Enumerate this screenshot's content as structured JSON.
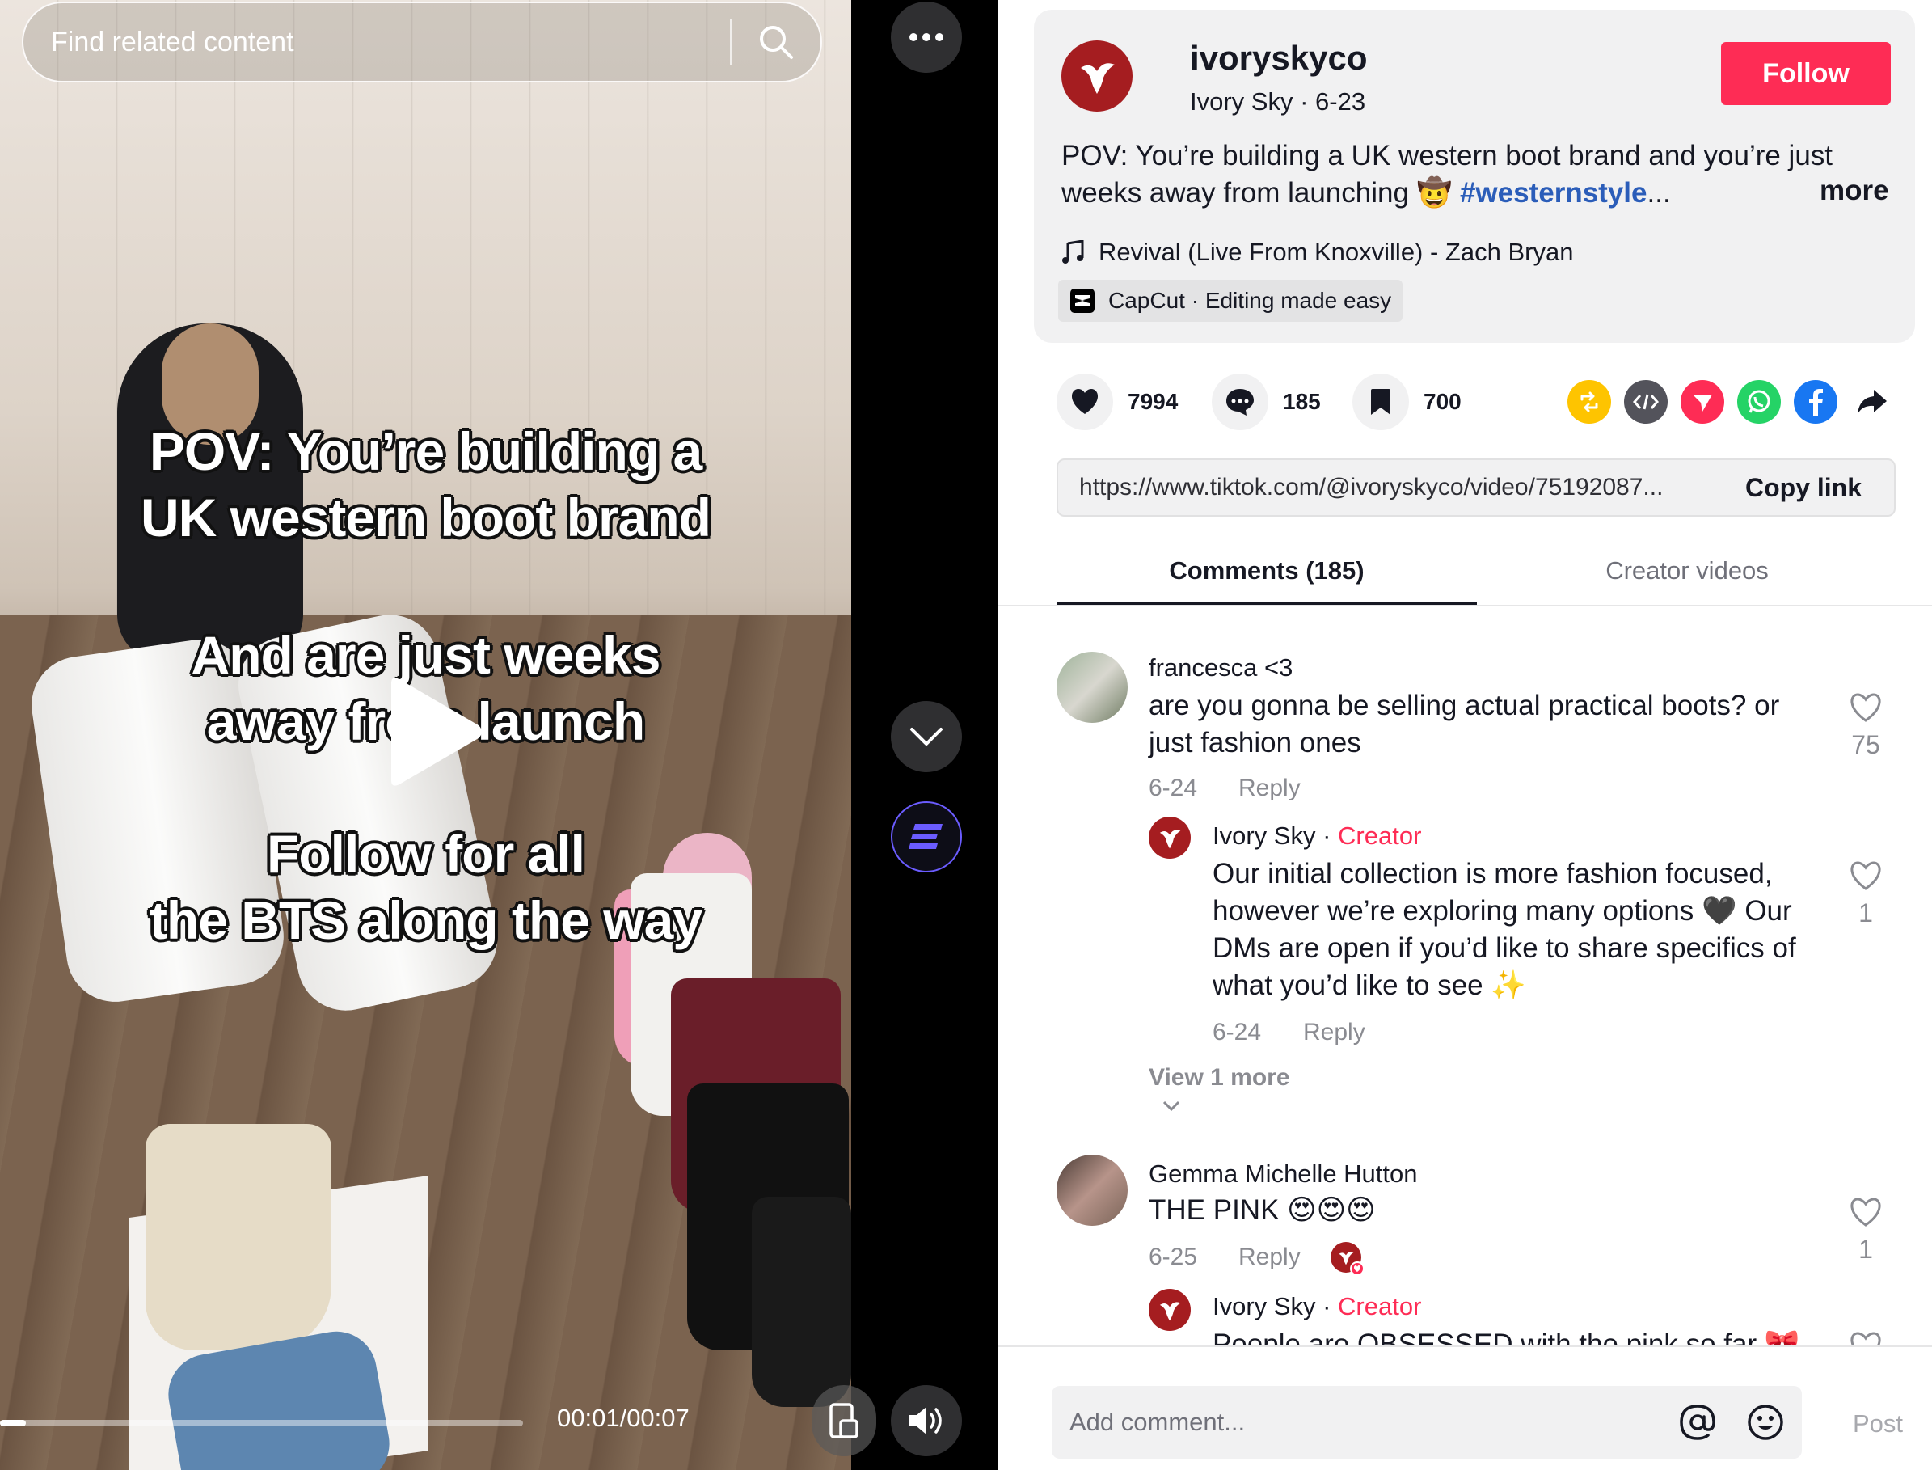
{
  "video": {
    "search_placeholder": "Find related content",
    "caption_lines": [
      "POV: You’re building a",
      "UK western boot brand",
      "And are just weeks",
      "away from launch",
      "Follow for all",
      "the BTS along the way"
    ],
    "time": "00:01/00:07",
    "progress_fraction": 0.05
  },
  "post": {
    "handle": "ivoryskyco",
    "meta": "Ivory Sky · 6-23",
    "follow_label": "Follow",
    "description_text": "POV: You’re building a UK western boot brand and you’re just weeks away from launching 🤠 ",
    "description_hashtag": "#westernstyle",
    "description_ellipsis": "...",
    "more_label": "more",
    "music": "Revival (Live From Knoxville) - Zach Bryan",
    "capcut": "CapCut · Editing made easy"
  },
  "stats": {
    "likes": "7994",
    "comments": "185",
    "saves": "700"
  },
  "link": {
    "url": "https://www.tiktok.com/@ivoryskyco/video/75192087...",
    "copy_label": "Copy link"
  },
  "tabs": {
    "comments": "Comments (185)",
    "creator": "Creator videos"
  },
  "comments": [
    {
      "name": "francesca <3",
      "text_lines": [
        "are you gonna be selling actual practical boots? or",
        "just fashion ones"
      ],
      "date": "6-24",
      "reply": "Reply",
      "likes": "75"
    },
    {
      "name": "Ivory Sky",
      "creator_tag": "Creator",
      "text_lines": [
        "Our initial collection is more fashion focused,",
        "however we’re exploring many options 🖤 Our",
        "DMs are open if you’d like to share specifics of",
        "what you’d like to see ✨"
      ],
      "date": "6-24",
      "reply": "Reply",
      "likes": "1"
    },
    {
      "view_more": "View 1 more"
    },
    {
      "name": "Gemma Michelle Hutton",
      "text": "THE PINK 😍😍😍",
      "date": "6-25",
      "reply": "Reply",
      "likes": "1"
    },
    {
      "name": "Ivory Sky",
      "creator_tag": "Creator",
      "text": "People are OBSESSED with the pink so far 🎀"
    }
  ],
  "footer": {
    "placeholder": "Add comment...",
    "post_label": "Post"
  },
  "colors": {
    "accent": "#fe2c55",
    "hashtag": "#2b5db9",
    "brand_red": "#a51d20"
  }
}
